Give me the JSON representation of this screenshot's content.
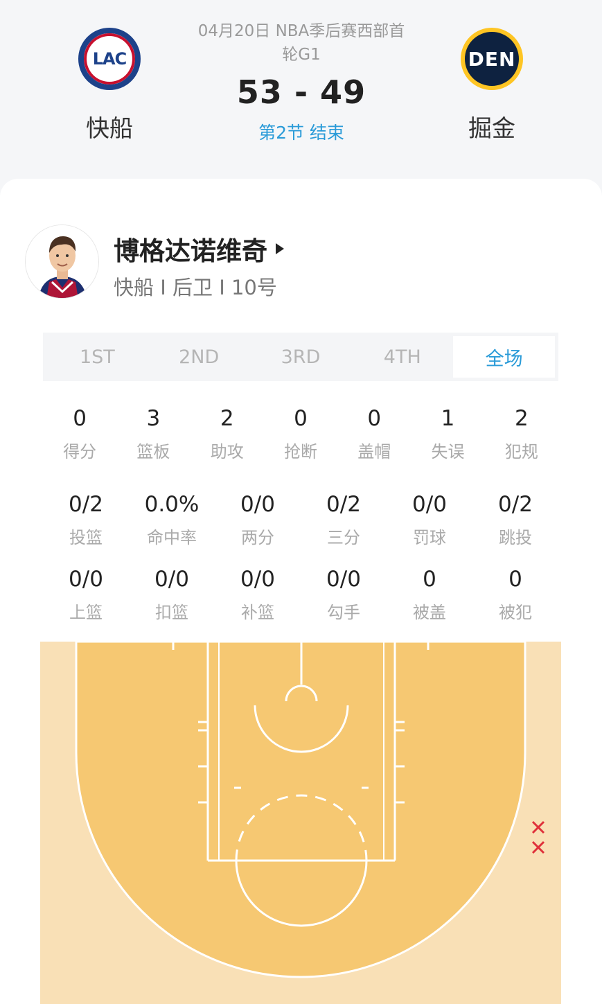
{
  "game": {
    "date_line1": "04月20日 NBA季后赛西部首",
    "date_line2": "轮G1",
    "score": "53 - 49",
    "period": "第2节 结束",
    "home": {
      "name": "快船",
      "logo_text": "LAC"
    },
    "away": {
      "name": "掘金",
      "logo_text": "DEN"
    }
  },
  "player": {
    "name": "博格达诺维奇",
    "meta": "快船 I 后卫 I 10号",
    "avatar_icon": "player-portrait"
  },
  "tabs": [
    {
      "label": "1ST",
      "active": false
    },
    {
      "label": "2ND",
      "active": false
    },
    {
      "label": "3RD",
      "active": false
    },
    {
      "label": "4TH",
      "active": false
    },
    {
      "label": "全场",
      "active": true
    }
  ],
  "stats_basic": [
    {
      "value": "0",
      "label": "得分"
    },
    {
      "value": "3",
      "label": "篮板"
    },
    {
      "value": "2",
      "label": "助攻"
    },
    {
      "value": "0",
      "label": "抢断"
    },
    {
      "value": "0",
      "label": "盖帽"
    },
    {
      "value": "1",
      "label": "失误"
    },
    {
      "value": "2",
      "label": "犯规"
    }
  ],
  "stats_shooting": [
    {
      "value": "0/2",
      "label": "投篮"
    },
    {
      "value": "0.0%",
      "label": "命中率"
    },
    {
      "value": "0/0",
      "label": "两分"
    },
    {
      "value": "0/2",
      "label": "三分"
    },
    {
      "value": "0/0",
      "label": "罚球"
    },
    {
      "value": "0/2",
      "label": "跳投"
    }
  ],
  "stats_detail": [
    {
      "value": "0/0",
      "label": "上篮"
    },
    {
      "value": "0/0",
      "label": "扣篮"
    },
    {
      "value": "0/0",
      "label": "补篮"
    },
    {
      "value": "0/0",
      "label": "勾手"
    },
    {
      "value": "0",
      "label": "被盖"
    },
    {
      "value": "0",
      "label": "被犯"
    }
  ],
  "colors": {
    "accent": "#2a9bd8",
    "court_paint": "#f6c872",
    "court_outer": "#f9e0b6",
    "miss_marker": "#e0313a"
  },
  "shot_chart": {
    "misses": 2
  }
}
